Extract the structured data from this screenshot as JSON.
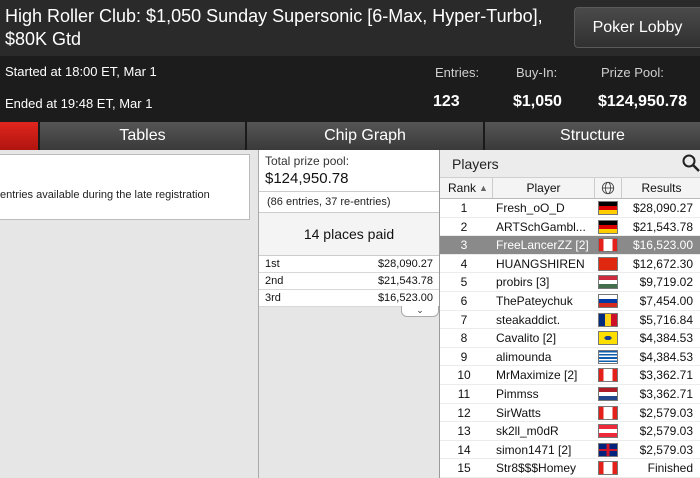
{
  "window": {
    "title": "High Roller Club: $1,050 Sunday Supersonic [6-Max, Hyper-Turbo], $80K Gtd",
    "lobby_button": "Poker Lobby"
  },
  "info": {
    "started": "Started at 18:00 ET, Mar 1",
    "ended": "Ended at 19:48 ET, Mar 1",
    "entries_label": "Entries:",
    "entries_value": "123",
    "buyin_label": "Buy-In:",
    "buyin_value": "$1,050",
    "prize_label": "Prize Pool:",
    "prize_value": "$124,950.78"
  },
  "tabs": [
    "",
    "Tables",
    "Chip Graph",
    "Structure"
  ],
  "left_panel": {
    "text": "entries available during the late registration"
  },
  "prize_panel": {
    "total_label": "Total prize pool:",
    "total_value": "$124,950.78",
    "entries_note": "(86 entries, 37 re-entries)",
    "places_paid": "14 places paid",
    "payouts": [
      {
        "place": "1st",
        "amount": "$28,090.27"
      },
      {
        "place": "2nd",
        "amount": "$21,543.78"
      },
      {
        "place": "3rd",
        "amount": "$16,523.00"
      }
    ]
  },
  "players_panel": {
    "title": "Players",
    "columns": {
      "rank": "Rank",
      "player": "Player",
      "results": "Results"
    },
    "rows": [
      {
        "rank": "1",
        "name": "Fresh_oO_D",
        "result": "$28,090.27",
        "flag": "germany"
      },
      {
        "rank": "2",
        "name": "ARTSchGambl...",
        "result": "$21,543.78",
        "flag": "germany"
      },
      {
        "rank": "3",
        "name": "FreeLancerZZ [2]",
        "result": "$16,523.00",
        "flag": "canada"
      },
      {
        "rank": "4",
        "name": "HUANGSHIREN",
        "result": "$12,672.30",
        "flag": "china"
      },
      {
        "rank": "5",
        "name": "probirs [3]",
        "result": "$9,719.02",
        "flag": "hungary"
      },
      {
        "rank": "6",
        "name": "ThePateychuk",
        "result": "$7,454.00",
        "flag": "russia"
      },
      {
        "rank": "7",
        "name": "steakaddict.",
        "result": "$5,716.84",
        "flag": "romania"
      },
      {
        "rank": "8",
        "name": "Cavalito [2]",
        "result": "$4,384.53",
        "flag": "brazil"
      },
      {
        "rank": "9",
        "name": "alimounda",
        "result": "$4,384.53",
        "flag": "greece"
      },
      {
        "rank": "10",
        "name": "MrMaximize [2]",
        "result": "$3,362.71",
        "flag": "canada"
      },
      {
        "rank": "11",
        "name": "Pimmss",
        "result": "$3,362.71",
        "flag": "netherlands"
      },
      {
        "rank": "12",
        "name": "SirWatts",
        "result": "$2,579.03",
        "flag": "canada"
      },
      {
        "rank": "13",
        "name": "sk2ll_m0dR",
        "result": "$2,579.03",
        "flag": "austria"
      },
      {
        "rank": "14",
        "name": "simon1471 [2]",
        "result": "$2,579.03",
        "flag": "uk"
      },
      {
        "rank": "15",
        "name": "Str8$$$Homey",
        "result": "Finished",
        "flag": "canada"
      }
    ]
  }
}
